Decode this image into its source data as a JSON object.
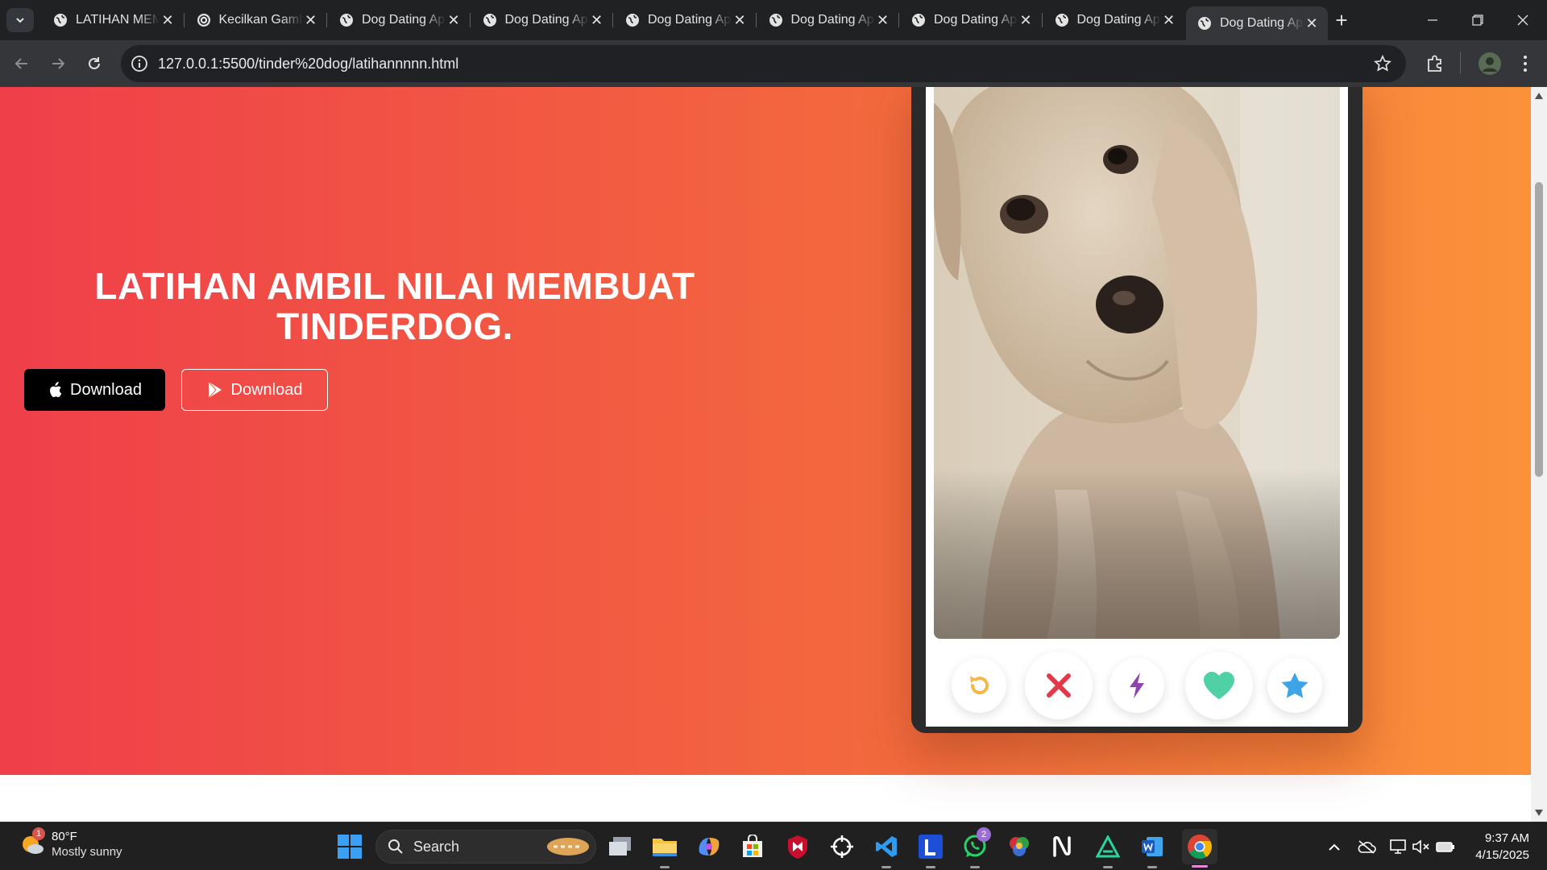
{
  "browser": {
    "tabs": [
      {
        "title": "LATIHAN MEMBUAT",
        "icon": "globe-icon",
        "active": false
      },
      {
        "title": "Kecilkan Gambar",
        "icon": "spiral-icon",
        "active": false
      },
      {
        "title": "Dog Dating App",
        "icon": "globe-icon",
        "active": false
      },
      {
        "title": "Dog Dating App",
        "icon": "globe-icon",
        "active": false
      },
      {
        "title": "Dog Dating App",
        "icon": "globe-icon",
        "active": false
      },
      {
        "title": "Dog Dating App",
        "icon": "globe-icon",
        "active": false
      },
      {
        "title": "Dog Dating App",
        "icon": "globe-icon",
        "active": false
      },
      {
        "title": "Dog Dating App",
        "icon": "globe-icon",
        "active": false
      },
      {
        "title": "Dog Dating App",
        "icon": "globe-icon",
        "active": true
      }
    ],
    "close_glyph": "✕",
    "new_tab_glyph": "+",
    "url": "127.0.0.1:5500/tinder%20dog/latihannnnn.html"
  },
  "page": {
    "hero_title": "LATIHAN AMBIL NILAI MEMBUAT TINDERDOG.",
    "apple_download_label": "Download",
    "play_download_label": "Download",
    "action_buttons": [
      "rewind-icon",
      "nope-icon",
      "boost-icon",
      "like-icon",
      "super-like-icon"
    ],
    "colors": {
      "gradient_start": "#ef3f4a",
      "gradient_end": "#fb923a",
      "rewind": "#f5b748",
      "nope": "#e23a4a",
      "boost": "#8e44ad",
      "like": "#4fd1a5",
      "super_like": "#3fa3e8"
    }
  },
  "taskbar": {
    "weather_temp": "80°F",
    "weather_condition": "Mostly sunny",
    "weather_badge": "1",
    "search_label": "Search",
    "whatsapp_badge": "2",
    "time": "9:37 AM",
    "date": "4/15/2025"
  }
}
